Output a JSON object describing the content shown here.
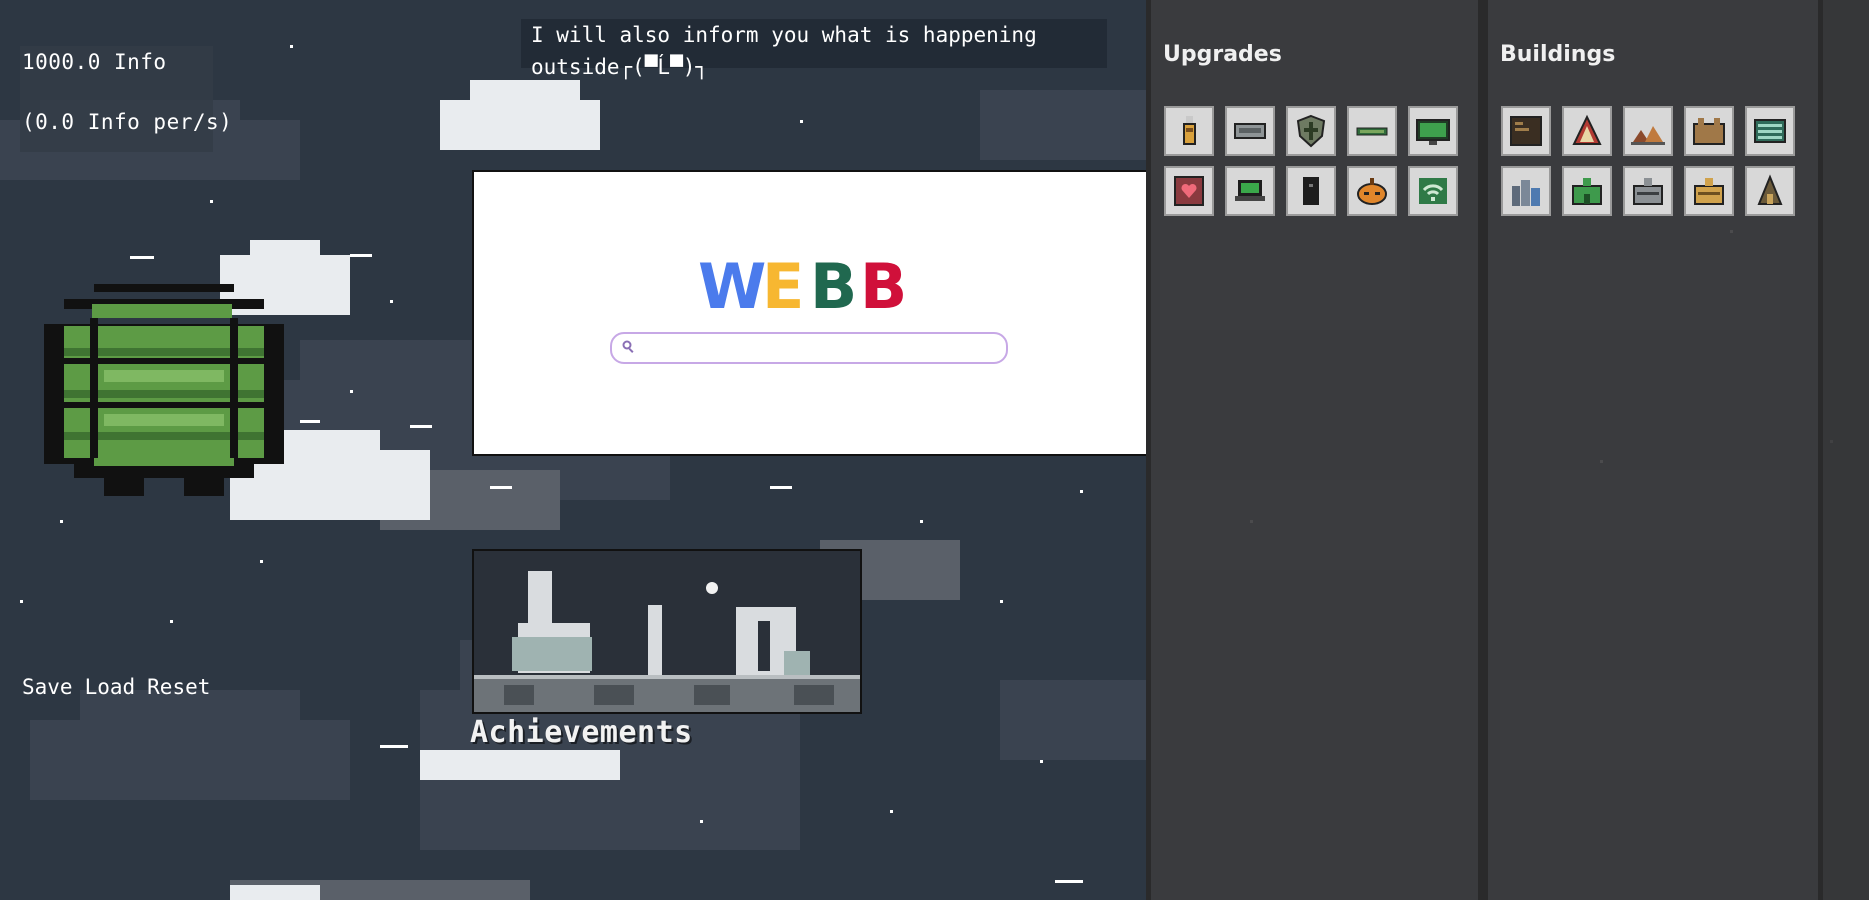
{
  "stats": {
    "info": "1000.0 Info",
    "rate": "(0.0 Info per/s)"
  },
  "news": {
    "line1": "I will also inform you what is happening",
    "line2": "outside┌(▀Ĺ▀)┐"
  },
  "search": {
    "logo_letters": [
      "W",
      "E",
      "B",
      "B"
    ],
    "logo_colors": [
      "#4b7bec",
      "#f7b731",
      "#20684f",
      "#d0103a"
    ],
    "placeholder": ""
  },
  "achievements": {
    "title": "Achievements"
  },
  "controls": {
    "save": "Save",
    "load": "Load",
    "reset": "Reset"
  },
  "upgrades": {
    "title": "Upgrades",
    "items": [
      "usb-stick-icon",
      "router-icon",
      "shield-icon",
      "ram-stick-icon",
      "monitor-icon",
      "heart-chip-icon",
      "laptop-icon",
      "server-tower-icon",
      "pumpkin-bot-icon",
      "wifi-icon"
    ]
  },
  "buildings": {
    "title": "Buildings",
    "items": [
      "computer-screen-icon",
      "warning-tower-icon",
      "tent-camp-icon",
      "warehouse-icon",
      "server-rack-icon",
      "city-icon",
      "green-building-icon",
      "office-icon",
      "bank-icon",
      "castle-icon"
    ]
  },
  "colors": {
    "background": "#2d3743",
    "panel": "#3c3c3e",
    "planet_green": "#5d9b45"
  }
}
